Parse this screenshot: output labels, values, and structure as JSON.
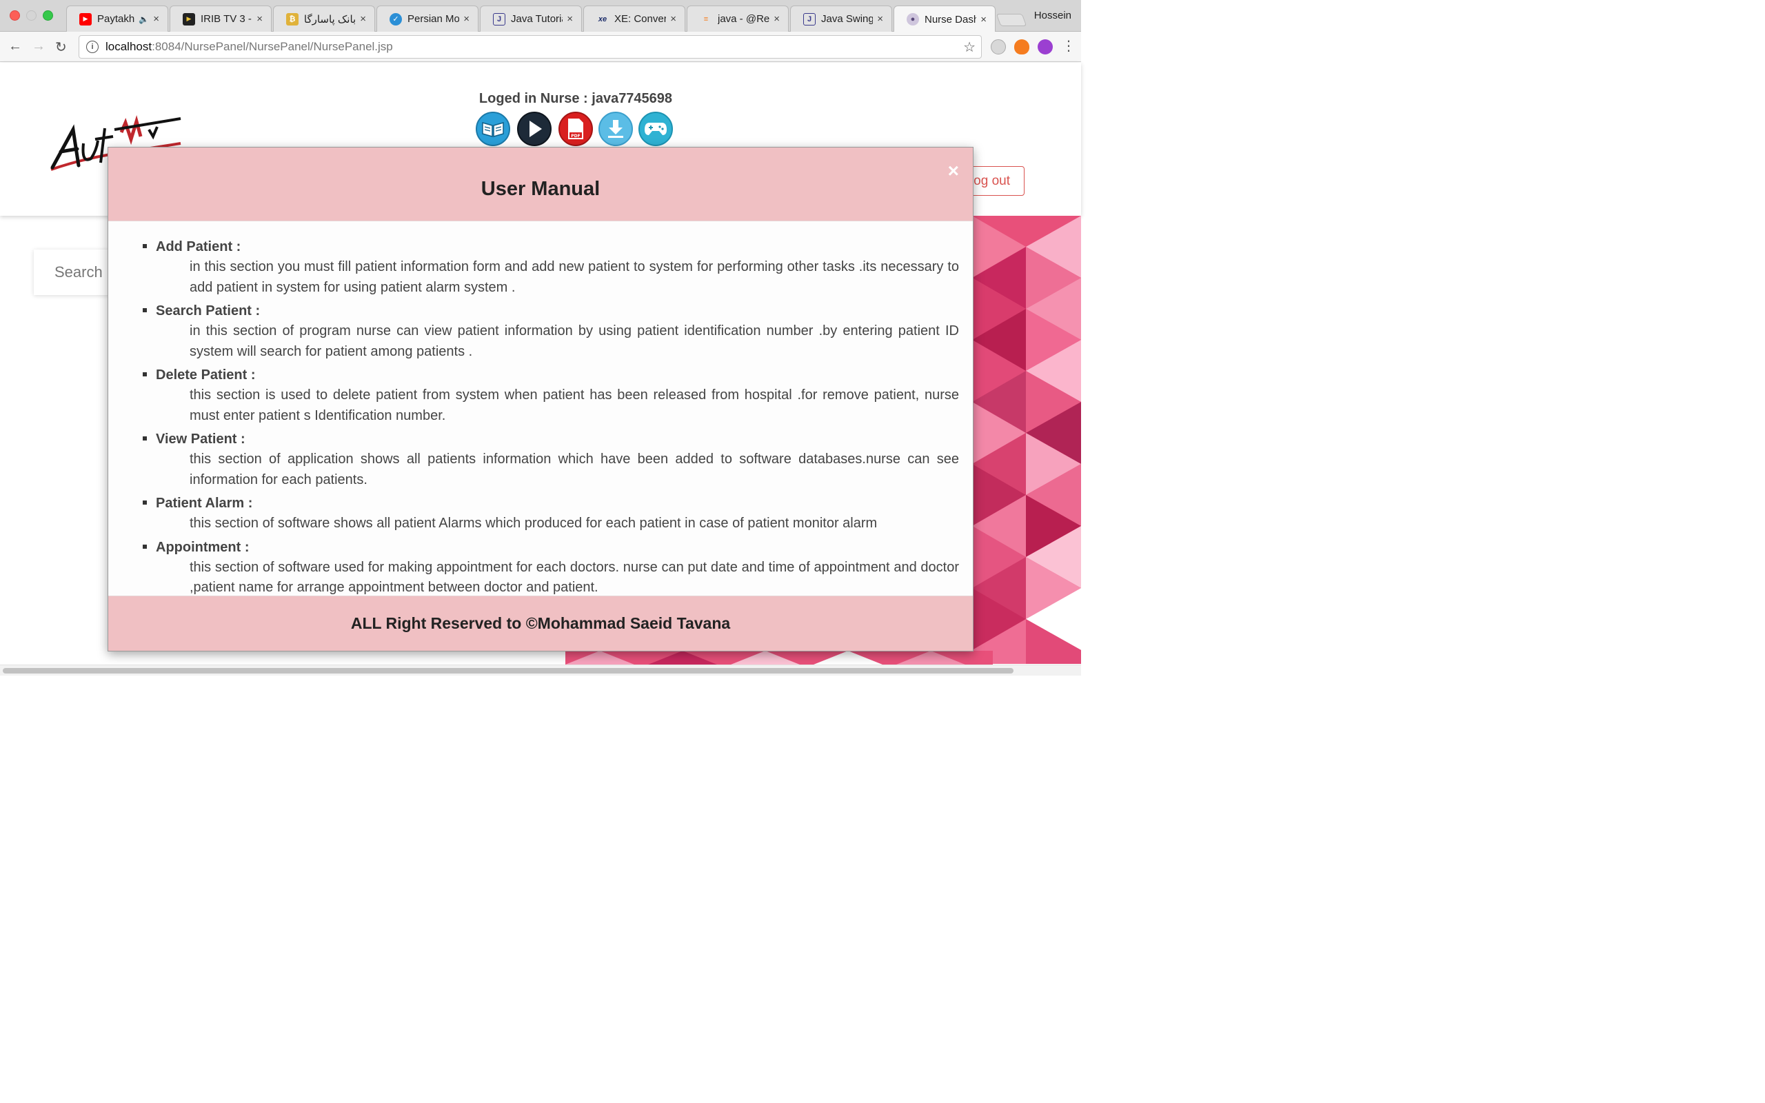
{
  "browser": {
    "tabs": [
      {
        "title": "Paytakht",
        "favicon": "youtube-icon",
        "fav_color": "#ff0000",
        "audio": true
      },
      {
        "title": "IRIB TV 3 - ",
        "favicon": "play-icon",
        "fav_color": "#222222",
        "audio": false
      },
      {
        "title": "بانک پاسارگاد ::",
        "favicon": "bank-icon",
        "fav_color": "#e0b23a",
        "audio": false
      },
      {
        "title": "Persian Mov",
        "favicon": "globe-icon",
        "fav_color": "#2b8fd6",
        "audio": false
      },
      {
        "title": "Java Tutoria",
        "favicon": "book-icon",
        "fav_color": "#3a3a8c",
        "audio": false
      },
      {
        "title": "XE: Convert",
        "favicon": "xe-icon",
        "fav_color": "#1f2f6b",
        "audio": false
      },
      {
        "title": "java - @Req",
        "favicon": "stack-icon",
        "fav_color": "#f48024",
        "audio": false
      },
      {
        "title": "Java Swing",
        "favicon": "book-icon",
        "fav_color": "#3a3a8c",
        "audio": false
      },
      {
        "title": "Nurse Dash",
        "favicon": "avatar-icon",
        "fav_color": "#7a6a9a",
        "audio": false
      }
    ],
    "profile_name": "Hossein",
    "url_host": "localhost",
    "url_rest": ":8084/NursePanel/NursePanel/NursePanel.jsp"
  },
  "header": {
    "logged_in": "Loged in Nurse : java7745698",
    "logout_label": "Log out",
    "quick_icons": [
      "manual-book-icon",
      "play-video-icon",
      "pdf-icon",
      "download-icon",
      "gamepad-icon"
    ]
  },
  "search": {
    "placeholder": "Search p"
  },
  "modal": {
    "title": "User Manual",
    "close_symbol": "×",
    "items": [
      {
        "heading": "Add Patient :",
        "desc": "in this section you must fill patient information form and add new patient to system for performing other tasks .its necessary to add patient in system for using patient alarm system ."
      },
      {
        "heading": "Search Patient :",
        "desc": "in this section of program nurse can view patient information by using patient identification number .by entering patient ID system will search for patient among patients ."
      },
      {
        "heading": "Delete Patient :",
        "desc": "this section is used to delete patient from system when patient has been released from hospital .for remove patient, nurse must enter patient s Identification number."
      },
      {
        "heading": "View Patient :",
        "desc": "this section of application shows all patients information which have been added to software databases.nurse can see information for each patients."
      },
      {
        "heading": "Patient Alarm :",
        "desc": "this section of software shows all patient Alarms which produced for each patient in case of patient monitor alarm"
      },
      {
        "heading": "Appointment :",
        "desc": "this section of software used for making appointment for each doctors. nurse can put date and time of appointment and doctor ,patient name for arrange appointment between doctor and patient."
      }
    ],
    "footer": "ALL Right Reserved to ©Mohammad Saeid Tavana"
  },
  "colors": {
    "modal_header_bg": "#f0c0c3",
    "logout_red": "#d9534f",
    "accent_blue": "#1e9ad6"
  }
}
